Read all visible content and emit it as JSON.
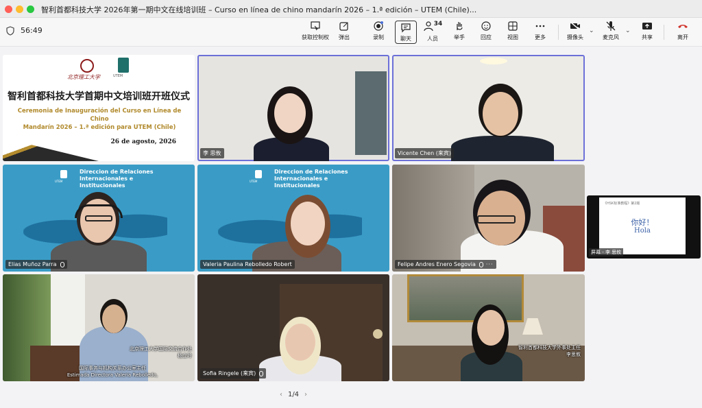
{
  "window": {
    "title": "智利首都科技大学 2026年第一期中文在线培训班 – Curso en línea de chino mandarín 2026 – 1.ª edición – UTEM (Chile)..."
  },
  "toolbar": {
    "timer": "56:49",
    "items": [
      {
        "label": "获取控制权",
        "icon": "remote-control-icon"
      },
      {
        "label": "弹出",
        "icon": "popout-icon"
      },
      {
        "label": "录制",
        "icon": "record-icon"
      },
      {
        "label": "聊天",
        "icon": "chat-icon"
      },
      {
        "label": "人员",
        "icon": "people-icon",
        "count": "34"
      },
      {
        "label": "举手",
        "icon": "raise-hand-icon"
      },
      {
        "label": "回应",
        "icon": "reaction-icon"
      },
      {
        "label": "视图",
        "icon": "view-grid-icon"
      },
      {
        "label": "更多",
        "icon": "more-icon"
      },
      {
        "label": "摄像头",
        "icon": "camera-off-icon"
      },
      {
        "label": "麦克风",
        "icon": "mic-off-icon"
      },
      {
        "label": "共享",
        "icon": "share-icon"
      },
      {
        "label": "离开",
        "icon": "hangup-icon"
      }
    ],
    "accent_leave": "#d0342c"
  },
  "slide": {
    "uni_caption": "北京理工大学",
    "utem_caption": "UTEM",
    "title": "智利首都科技大学首期中文培训班开班仪式",
    "subtitle_line1": "Ceremonia de Inauguración del Curso en Línea de Chino",
    "subtitle_line2": "Mandarín 2026 – 1.ª edición para UTEM (Chile)",
    "date": "26 de agosto, 2026"
  },
  "vbg": {
    "heading_line1": "Direccion de Relaciones",
    "heading_line2": "Internacionales e",
    "heading_line3": "Institucionales",
    "logo_caption": "UTEM"
  },
  "participants": {
    "p1": "李 思攸",
    "p2": "Vicente Chen (来宾)",
    "p3": "Elias Muñoz Parra",
    "p4": "Valeria Paulina Rebolledo Robert",
    "p5": "Felipe Andres Enero Segovia",
    "p6": "Sofia Ringele (来宾)"
  },
  "subtitles": {
    "s1_line1": "北京理工大学国际交流合作处",
    "s1_line2": "杨立玲",
    "s2_line1": "国际事务与机构关系办公室主任",
    "s2_line2": "Estimada Directora Valeria Rebolledo,",
    "s3_line1": "智利首都科技大学外事处主任",
    "s3_line2": "李思攸"
  },
  "pagination": {
    "label": "1/4"
  },
  "share": {
    "header": "《HSK标准教程》第2版",
    "line1": "你好！",
    "line2": "Hola",
    "tag": "屏幕 - 李 思攸"
  }
}
